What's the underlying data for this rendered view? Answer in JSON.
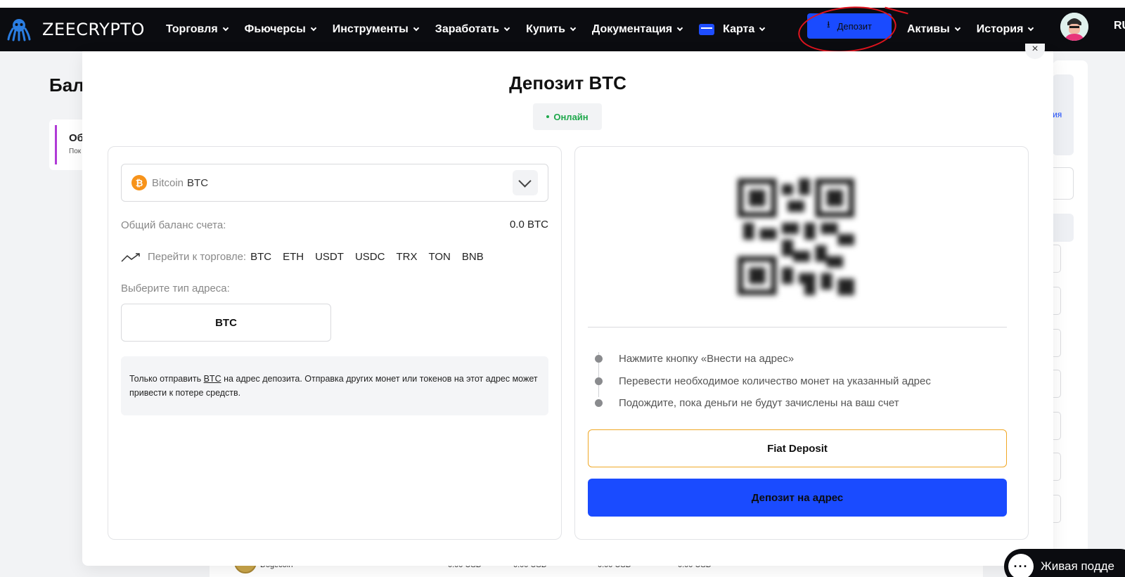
{
  "brand": {
    "name": "ZEECRYPTO"
  },
  "nav": {
    "items": [
      {
        "label": "Торговля"
      },
      {
        "label": "Фьючерсы"
      },
      {
        "label": "Инструменты"
      },
      {
        "label": "Заработать"
      },
      {
        "label": "Купить"
      },
      {
        "label": "Документация"
      },
      {
        "label": "Карта"
      }
    ],
    "deposit_label": "Депозит",
    "right_items": [
      {
        "label": "Активы"
      },
      {
        "label": "История"
      }
    ],
    "lang": "RU"
  },
  "background": {
    "title": "Бал",
    "card_title": "Об",
    "card_sub": "Пок",
    "right_link": "ия",
    "bottom_row": {
      "coin": "Dogecoin",
      "v1": "0.00 USD",
      "v2": "0.00 USD",
      "v3": "0.00 USD",
      "v4": "0.00 USD"
    },
    "chat_label": "Живая подде"
  },
  "modal": {
    "title": "Депозит BTC",
    "status": "Онлайн",
    "close": "×",
    "coin": {
      "name": "Bitcoin",
      "ticker": "BTC"
    },
    "balance_label": "Общий баланс счета:",
    "balance_value": "0.0 BTC",
    "trade_label": "Перейти к торговле:",
    "trade_links": [
      "BTC",
      "ETH",
      "USDT",
      "USDC",
      "TRX",
      "TON",
      "BNB"
    ],
    "address_type_label": "Выберите тип адреса:",
    "address_type": "BTC",
    "warning_pre": "Только отправить ",
    "warning_coin": "BTC",
    "warning_post": " на адрес депозита. Отправка других монет или токенов на этот адрес может привести к потере средств.",
    "steps": [
      "Нажмите кнопку «Внести на адрес»",
      "Перевести необходимое количество монет на указанный адрес",
      "Подождите, пока деньги не будут зачислены на ваш счет"
    ],
    "fiat_button": "Fiat Deposit",
    "deposit_button": "Депозит на адрес"
  },
  "colors": {
    "accent": "#1a4bff",
    "nav_bg": "#0b0c10",
    "online": "#1ea84b",
    "bitcoin": "#f7931a",
    "fiat_border": "#f0a826",
    "annotation": "#e0141e"
  }
}
